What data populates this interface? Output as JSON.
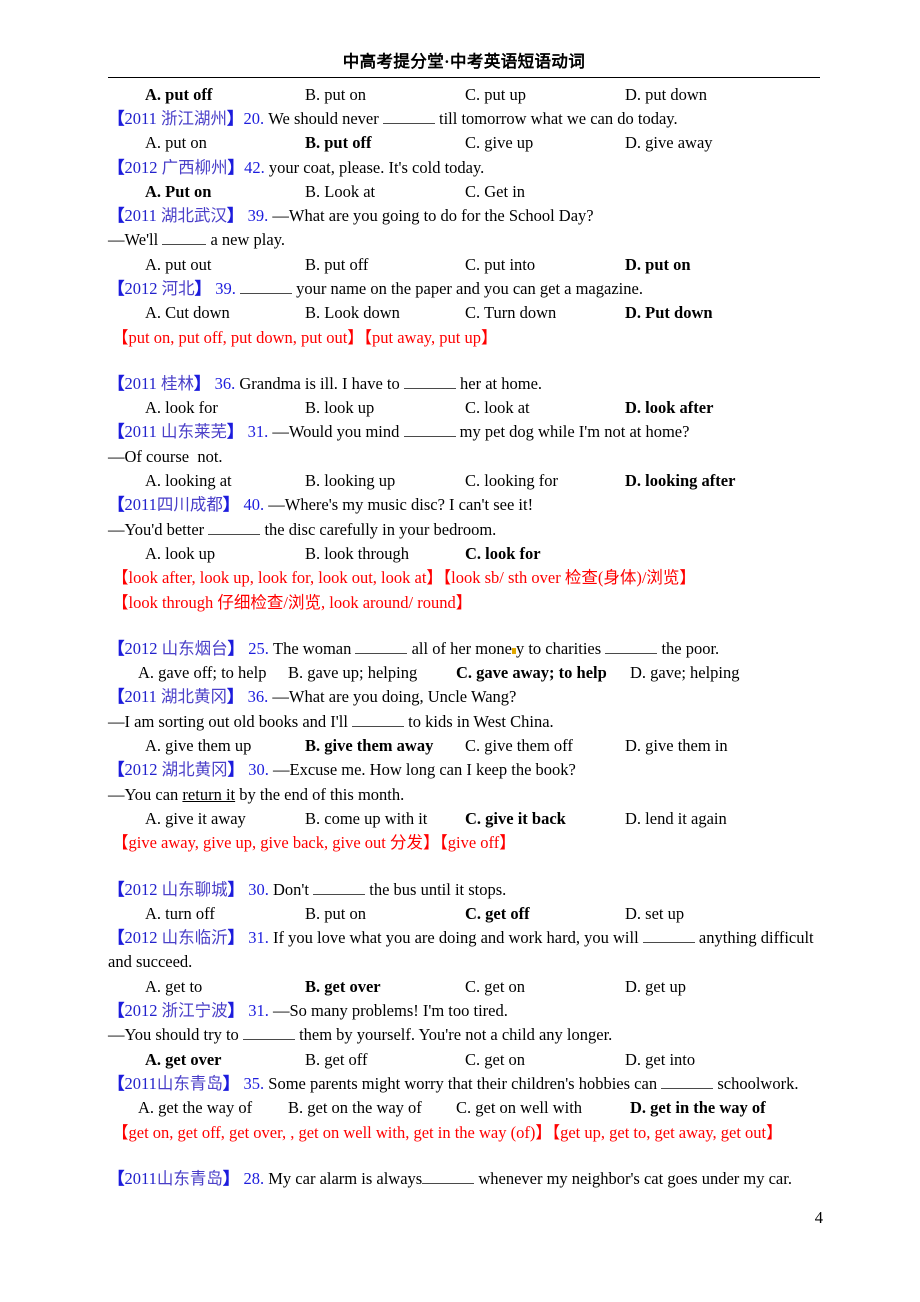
{
  "header": {
    "title": "中高考提分堂·中考英语短语动词"
  },
  "page_number": "4",
  "blocks": [
    {
      "options": [
        {
          "label": "A. put off",
          "bold": true
        },
        {
          "label": "B. put on",
          "bold": false
        },
        {
          "label": "C. put up",
          "bold": false
        },
        {
          "label": "D. put down",
          "bold": false
        }
      ]
    },
    {
      "tag": {
        "open": "【",
        "year": "2011 ",
        "place": "浙江湖州",
        "close": "】"
      },
      "qnum": "20.",
      "stem_before": " We should never ",
      "stem_after": " till tomorrow what we can do today.",
      "options": [
        {
          "label": "A. put on",
          "bold": false
        },
        {
          "label": "B. put off",
          "bold": true
        },
        {
          "label": "C. give up",
          "bold": false
        },
        {
          "label": "D. give away",
          "bold": false
        }
      ]
    },
    {
      "tag": {
        "open": "【",
        "year": "2012 ",
        "place": "广西柳州",
        "close": "】"
      },
      "qnum": "42.",
      "stem_before": "       ",
      "stem_after": " your coat, please. It's cold today.",
      "options": [
        {
          "label": "A. Put on",
          "bold": true
        },
        {
          "label": "B. Look at",
          "bold": false
        },
        {
          "label": "C. Get in",
          "bold": false
        }
      ]
    },
    {
      "tag": {
        "open": "【",
        "year": "2011 ",
        "place": "湖北武汉",
        "close": "】"
      },
      "qnum": " 39.",
      "stem_line": " —What are you going to do for the School Day?",
      "reply_before": "—We'll ",
      "reply_after": " a new play.",
      "options": [
        {
          "label": "A. put out",
          "bold": false
        },
        {
          "label": "B. put off",
          "bold": false
        },
        {
          "label": "C. put into",
          "bold": false
        },
        {
          "label": "D. put on",
          "bold": true
        }
      ]
    },
    {
      "tag": {
        "open": "【",
        "year": "2012 ",
        "place": "河北",
        "close": "】"
      },
      "qnum": " 39.",
      "stem_before": " ",
      "stem_after": " your name on the paper and you can get a magazine.",
      "options": [
        {
          "label": "A. Cut down",
          "bold": false
        },
        {
          "label": "B. Look down",
          "bold": false
        },
        {
          "label": "C. Turn down",
          "bold": false
        },
        {
          "label": "D. Put down",
          "bold": true
        }
      ]
    },
    {
      "notes": [
        "【put on, put off, put down, put out】【put away, put up】"
      ]
    },
    {
      "tag": {
        "open": "【",
        "year": "2011 ",
        "place": "桂林",
        "close": "】"
      },
      "qnum": " 36.",
      "stem_before": " Grandma is ill. I have to ",
      "stem_after": " her at home.",
      "options": [
        {
          "label": "A. look for",
          "bold": false
        },
        {
          "label": "B. look up",
          "bold": false
        },
        {
          "label": "C. look at",
          "bold": false
        },
        {
          "label": "D. look after",
          "bold": true
        }
      ]
    },
    {
      "tag": {
        "open": "【",
        "year": "2011 ",
        "place": "山东莱芜",
        "close": "】"
      },
      "qnum": " 31.",
      "stem_before": " —Would you mind ",
      "stem_after": " my pet dog while I'm not at home?",
      "reply_plain": "—Of course  not.",
      "options": [
        {
          "label": "A. looking at",
          "bold": false
        },
        {
          "label": "B. looking up",
          "bold": false
        },
        {
          "label": "C. looking for",
          "bold": false
        },
        {
          "label": "D. looking after",
          "bold": true
        }
      ]
    },
    {
      "tag": {
        "open": "【",
        "year": "2011",
        "place": "四川成都",
        "close": "】"
      },
      "qnum": " 40.",
      "stem_line": " —Where's my music disc? I can't see it!",
      "reply_before": "—You'd better ",
      "reply_after": " the disc carefully in your bedroom.",
      "options": [
        {
          "label": "A. look up",
          "bold": false
        },
        {
          "label": "B. look through",
          "bold": false
        },
        {
          "label": "C. look for",
          "bold": true
        }
      ]
    },
    {
      "notes": [
        "【look after, look up, look for, look out, look at】【look sb/ sth over 检查(身体)/浏览】",
        "【look through 仔细检查/浏览, look around/ round】"
      ]
    },
    {
      "tag": {
        "open": "【",
        "year": "2012 ",
        "place": "山东烟台",
        "close": "】"
      },
      "qnum": " 25.",
      "stem_before": " The woman ",
      "stem_mid": " all of her mone",
      "stem_mid2": "y to charities ",
      "stem_after": " the poor.",
      "options": [
        {
          "label": "A. gave off; to help",
          "bold": false
        },
        {
          "label": "B. gave up; helping",
          "bold": false
        },
        {
          "label": "C. gave away; to help",
          "bold": true
        },
        {
          "label": "D. gave; helping",
          "bold": false
        }
      ]
    },
    {
      "tag": {
        "open": "【",
        "year": "2011 ",
        "place": "湖北黄冈",
        "close": "】"
      },
      "qnum": " 36.",
      "stem_line": " —What are you doing, Uncle Wang?",
      "reply_before": "—I am sorting out old books and I'll ",
      "reply_after": " to kids in West China.",
      "options": [
        {
          "label": "A. give them up",
          "bold": false
        },
        {
          "label": "B. give them away",
          "bold": true
        },
        {
          "label": "C. give them off",
          "bold": false
        },
        {
          "label": "D. give them in",
          "bold": false
        }
      ]
    },
    {
      "tag": {
        "open": "【",
        "year": "2012 ",
        "place": "湖北黄冈",
        "close": "】"
      },
      "qnum": " 30.",
      "stem_line": " —Excuse me. How long can I keep the book?",
      "reply_plain_before": "—You can ",
      "reply_underline": "return it",
      "reply_plain_after": " by the end of this month.",
      "options": [
        {
          "label": "A. give it away",
          "bold": false
        },
        {
          "label": "B. come up with it",
          "bold": false
        },
        {
          "label": "C. give it back",
          "bold": true
        },
        {
          "label": "D. lend it again",
          "bold": false
        }
      ]
    },
    {
      "notes": [
        "【give away, give up, give back, give out 分发】【give off】"
      ]
    },
    {
      "tag": {
        "open": "【",
        "year": "2012 ",
        "place": "山东聊城",
        "close": "】"
      },
      "qnum": " 30.",
      "stem_before": " Don't ",
      "stem_after": " the bus until it stops.",
      "options": [
        {
          "label": "A. turn off",
          "bold": false
        },
        {
          "label": "B. put on",
          "bold": false
        },
        {
          "label": "C. get off",
          "bold": true
        },
        {
          "label": "D. set up",
          "bold": false
        }
      ]
    },
    {
      "tag": {
        "open": "【",
        "year": "2012 ",
        "place": "山东临沂",
        "close": "】"
      },
      "qnum": " 31.",
      "stem_before": " If you love what you are doing and work hard, you will ",
      "stem_after": " anything difficult",
      "stem_wrap": "and succeed.",
      "options": [
        {
          "label": "A. get to",
          "bold": false
        },
        {
          "label": "B. get over",
          "bold": true
        },
        {
          "label": "C. get on",
          "bold": false
        },
        {
          "label": "D. get up",
          "bold": false
        }
      ]
    },
    {
      "tag": {
        "open": "【",
        "year": "2012 ",
        "place": "浙江宁波",
        "close": "】"
      },
      "qnum": " 31.",
      "stem_line": " —So many problems! I'm too tired.",
      "reply_before": "—You should try to ",
      "reply_after": " them by yourself. You're not a child any longer.",
      "options": [
        {
          "label": "A. get over",
          "bold": true
        },
        {
          "label": "B. get off",
          "bold": false
        },
        {
          "label": "C. get on",
          "bold": false
        },
        {
          "label": "D. get into",
          "bold": false
        }
      ]
    },
    {
      "tag": {
        "open": "【",
        "year": "2011",
        "place": "山东青岛",
        "close": "】"
      },
      "qnum": " 35.",
      "stem_before": " Some parents might worry that their children's hobbies can ",
      "stem_after": " schoolwork.",
      "options": [
        {
          "label": "A. get the way of",
          "bold": false
        },
        {
          "label": "B. get on the way of",
          "bold": false
        },
        {
          "label": "C. get on well with",
          "bold": false
        },
        {
          "label": "D. get in the way of",
          "bold": true
        }
      ]
    },
    {
      "notes": [
        "【get on, get off, get over, , get on well with, get in the way (of)】【get up, get to, get away, get out】"
      ]
    },
    {
      "tag": {
        "open": "【",
        "year": "2011",
        "place": "山东青岛",
        "close": "】"
      },
      "qnum": " 28.",
      "stem_before": " My car alarm is always",
      "stem_after": " whenever my neighbor's cat goes under my car."
    }
  ]
}
